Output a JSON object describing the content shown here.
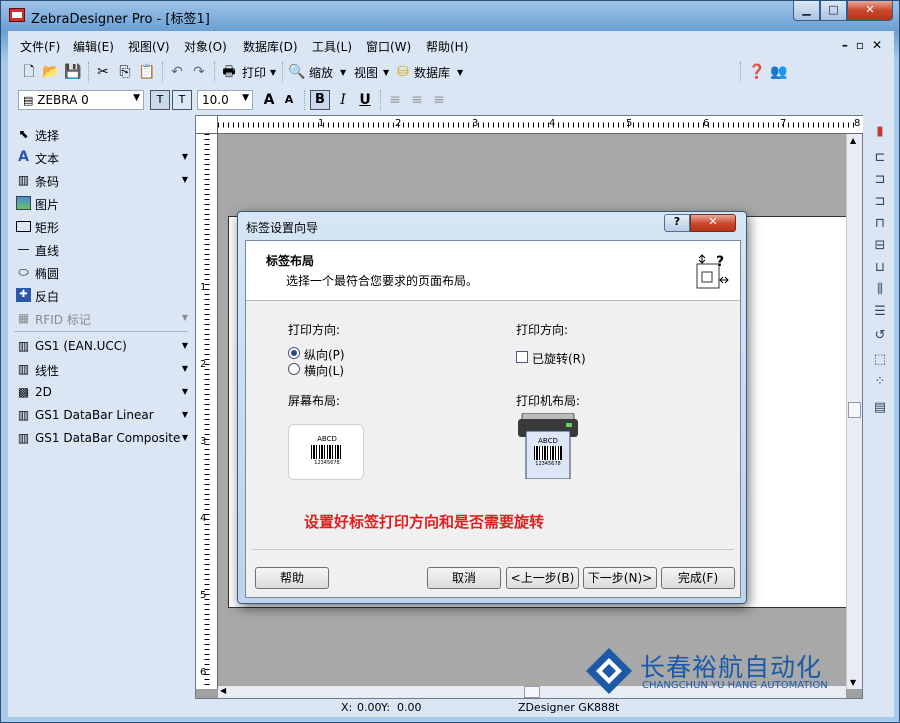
{
  "window": {
    "title": "ZebraDesigner Pro - [标签1]"
  },
  "menubar": {
    "items": [
      "文件(F)",
      "编辑(E)",
      "视图(V)",
      "对象(O)",
      "数据库(D)",
      "工具(L)",
      "窗口(W)",
      "帮助(H)"
    ]
  },
  "toolbar": {
    "print_label": "打印",
    "zoom_label": "缩放",
    "view_label": "视图",
    "database_label": "数据库"
  },
  "format_bar": {
    "font_value": "ZEBRA 0",
    "size_value": "10.0",
    "bold": "B",
    "italic": "I",
    "underline": "U"
  },
  "sidebar": {
    "items": [
      {
        "label": "选择",
        "icon": "cursor-icon"
      },
      {
        "label": "文本",
        "icon": "text-icon"
      },
      {
        "label": "条码",
        "icon": "barcode-icon"
      },
      {
        "label": "图片",
        "icon": "picture-icon"
      },
      {
        "label": "矩形",
        "icon": "rectangle-icon"
      },
      {
        "label": "直线",
        "icon": "line-icon"
      },
      {
        "label": "椭圆",
        "icon": "ellipse-icon"
      },
      {
        "label": "反白",
        "icon": "inverse-icon"
      },
      {
        "label": "RFID 标记",
        "icon": "rfid-icon"
      },
      {
        "label": "GS1 (EAN.UCC)",
        "icon": "gs1-icon"
      },
      {
        "label": "线性",
        "icon": "linear-barcode-icon"
      },
      {
        "label": "2D",
        "icon": "2d-barcode-icon"
      },
      {
        "label": "GS1 DataBar Linear",
        "icon": "databar-icon"
      },
      {
        "label": "GS1 DataBar Composite",
        "icon": "databar-composite-icon"
      }
    ]
  },
  "rulers": {
    "h_ticks": [
      "1",
      "2",
      "3",
      "4",
      "5",
      "6",
      "7",
      "8"
    ],
    "v_ticks": [
      "1",
      "2",
      "3",
      "4",
      "5",
      "6"
    ]
  },
  "statusbar": {
    "x_label": "X:",
    "x_value": "0.00",
    "y_label": "Y:",
    "y_value": "0.00",
    "printer": "ZDesigner GK888t"
  },
  "dialog": {
    "title": "标签设置向导",
    "help_glyph": "?",
    "close_glyph": "✕",
    "header_title": "标签布局",
    "header_subtitle": "选择一个最符合您要求的页面布局。",
    "print_direction_left": "打印方向:",
    "portrait_label": "纵向(P)",
    "landscape_label": "横向(L)",
    "print_direction_right": "打印方向:",
    "rotated_label": "已旋转(R)",
    "screen_layout": "屏幕布局:",
    "printer_layout": "打印机布局:",
    "preview_text": "ABCD",
    "preview_number": "12345678",
    "annotation": "设置好标签打印方向和是否需要旋转",
    "buttons": {
      "help": "帮助",
      "cancel": "取消",
      "back": "<上一步(B)",
      "next": "下一步(N)>",
      "finish": "完成(F)"
    }
  },
  "watermark": {
    "cn": "长春裕航自动化",
    "en": "CHANGCHUN YU HANG AUTOMATION"
  },
  "colors": {
    "annotation": "#e02020",
    "watermark": "#1c5aa8",
    "titlebar": "#6a9fd3"
  }
}
